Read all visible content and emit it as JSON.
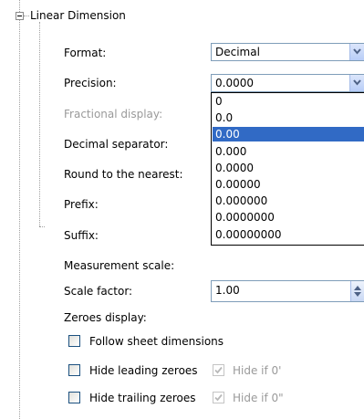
{
  "tree": {
    "node_label": "Linear Dimension"
  },
  "fields": {
    "format": {
      "label": "Format:",
      "value": "Decimal"
    },
    "precision": {
      "label": "Precision:",
      "value": "0.0000"
    },
    "fractional_display": {
      "label": "Fractional display:"
    },
    "decimal_separator": {
      "label": "Decimal separator:"
    },
    "round_to_nearest": {
      "label": "Round to the nearest:"
    },
    "prefix": {
      "label": "Prefix:"
    },
    "suffix": {
      "label": "Suffix:"
    },
    "measurement_scale": {
      "label": "Measurement scale:"
    },
    "scale_factor": {
      "label": "Scale factor:",
      "value": "1.00"
    },
    "zeroes_display": {
      "label": "Zeroes display:"
    }
  },
  "precision_dropdown": {
    "selected_index": 2,
    "options": [
      "0",
      "0.0",
      "0.00",
      "0.000",
      "0.0000",
      "0.00000",
      "0.000000",
      "0.0000000",
      "0.00000000"
    ]
  },
  "checkboxes": {
    "follow_sheet": {
      "label": "Follow sheet dimensions",
      "checked": false
    },
    "hide_leading": {
      "label": "Hide leading zeroes",
      "checked": false
    },
    "hide_if_0": {
      "label": "Hide if 0'",
      "checked": true,
      "disabled": true
    },
    "hide_trailing": {
      "label": "Hide trailing zeroes",
      "checked": false
    },
    "hide_if_0_inch": {
      "label": "Hide if 0\"",
      "checked": true,
      "disabled": true
    }
  },
  "colors": {
    "selection": "#316ac5",
    "combo_border": "#7f9db9",
    "disabled_text": "#9a9a9a"
  }
}
